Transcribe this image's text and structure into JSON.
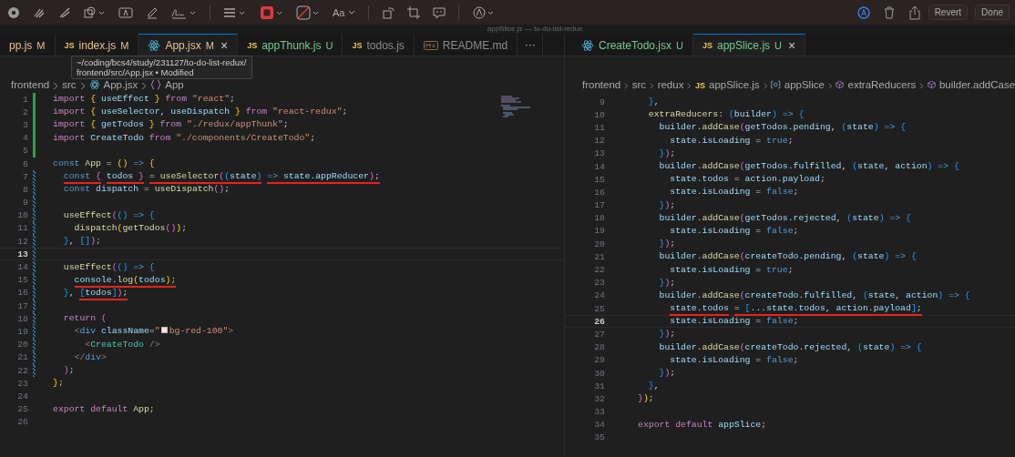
{
  "toolbar": {
    "font_label": "Aa",
    "buttons": [
      "Revert",
      "Done"
    ]
  },
  "window": {
    "title": "appSlice.js — to-do-list-redux"
  },
  "tooltip": {
    "lines": [
      "~/coding/bcs4/study/231127/to-do-list-redux/",
      "frontend/src/App.jsx • Modified"
    ]
  },
  "editors": [
    {
      "tabs": [
        {
          "label": "pp.js",
          "kind": "none",
          "status": "M",
          "color": "#e2c08d",
          "selected": false
        },
        {
          "label": "index.js",
          "kind": "js",
          "icon_text": "JS",
          "status": "M",
          "color": "#e2c08d",
          "selected": false
        },
        {
          "label": "App.jsx",
          "kind": "react",
          "status": "M",
          "color": "#e2c08d",
          "selected": true,
          "close": "×"
        },
        {
          "label": "appThunk.js",
          "kind": "js",
          "icon_text": "JS",
          "status": "U",
          "color": "#73c991",
          "selected": false
        },
        {
          "label": "todos.js",
          "kind": "js",
          "icon_text": "JS",
          "color": "#8b8b8b",
          "selected": false
        },
        {
          "label": "README.md",
          "kind": "markdown",
          "color": "#8b8b8b",
          "selected": false
        }
      ],
      "overflow_button": "···",
      "breadcrumb": [
        {
          "text": "frontend",
          "kind": "folder"
        },
        {
          "text": "src",
          "kind": "folder"
        },
        {
          "text": "App.jsx",
          "kind": "react"
        },
        {
          "text": "App",
          "kind": "symbol"
        }
      ],
      "lines": [
        {
          "number": "1",
          "added": true,
          "modified": false,
          "current": false,
          "tokens": [
            {
              "text": "import ",
              "kind": "kw"
            },
            {
              "text": "{",
              "kind": "br1"
            },
            {
              "text": " useEffect ",
              "kind": "var"
            },
            {
              "text": "}",
              "kind": "br1"
            },
            {
              "text": " from ",
              "kind": "kw"
            },
            {
              "text": "\"react\"",
              "kind": "str"
            },
            {
              "text": ";",
              "kind": "punc"
            }
          ]
        },
        {
          "number": "2",
          "added": true,
          "modified": false,
          "current": false,
          "tokens": [
            {
              "text": "import ",
              "kind": "kw"
            },
            {
              "text": "{",
              "kind": "br1"
            },
            {
              "text": " useSelector, useDispatch ",
              "kind": "var"
            },
            {
              "text": "}",
              "kind": "br1"
            },
            {
              "text": " from ",
              "kind": "kw"
            },
            {
              "text": "\"react-redux\"",
              "kind": "str"
            },
            {
              "text": ";",
              "kind": "punc"
            }
          ]
        },
        {
          "number": "3",
          "added": true,
          "modified": false,
          "current": false,
          "tokens": [
            {
              "text": "import ",
              "kind": "kw"
            },
            {
              "text": "{",
              "kind": "br1"
            },
            {
              "text": " getTodos ",
              "kind": "var"
            },
            {
              "text": "}",
              "kind": "br1"
            },
            {
              "text": " from ",
              "kind": "kw"
            },
            {
              "text": "\"./redux/appThunk\"",
              "kind": "str"
            },
            {
              "text": ";",
              "kind": "punc"
            }
          ]
        },
        {
          "number": "4",
          "added": true,
          "modified": false,
          "current": false,
          "tokens": [
            {
              "text": "import ",
              "kind": "kw"
            },
            {
              "text": "CreateTodo",
              "kind": "var"
            },
            {
              "text": " from ",
              "kind": "kw"
            },
            {
              "text": "\"./components/CreateTodo\"",
              "kind": "str"
            },
            {
              "text": ";",
              "kind": "punc"
            }
          ]
        },
        {
          "number": "5",
          "added": true,
          "modified": false,
          "current": false
        },
        {
          "number": "6",
          "added": false,
          "modified": false,
          "current": false,
          "tokens": [
            {
              "text": "const ",
              "kind": "decl"
            },
            {
              "text": "App",
              "kind": "fn"
            },
            {
              "text": " = ",
              "kind": "punc"
            },
            {
              "text": "()",
              "kind": "br1"
            },
            {
              "text": " => ",
              "kind": "decl"
            },
            {
              "text": "{",
              "kind": "br1"
            }
          ]
        },
        {
          "number": "7",
          "added": false,
          "modified": true,
          "current": false,
          "tokens": [
            {
              "text": "  const ",
              "kind": "decl",
              "underlined": true
            },
            {
              "text": "{",
              "kind": "br2",
              "underlined": true
            },
            {
              "text": " todos ",
              "kind": "var",
              "underlined": true
            },
            {
              "text": "}",
              "kind": "br2",
              "underlined": true
            },
            {
              "text": " = ",
              "kind": "punc",
              "underlined": true
            },
            {
              "text": "useSelector",
              "kind": "fn",
              "underlined": true
            },
            {
              "text": "(",
              "kind": "br2",
              "underlined": true
            },
            {
              "text": "(",
              "kind": "br3",
              "underlined": true
            },
            {
              "text": "state",
              "kind": "var",
              "underlined": true
            },
            {
              "text": ")",
              "kind": "br3",
              "underlined": true
            },
            {
              "text": " => ",
              "kind": "decl",
              "underlined": true
            },
            {
              "text": "state.appReducer",
              "kind": "var",
              "underlined": true
            },
            {
              "text": ")",
              "kind": "br2",
              "underlined": true
            },
            {
              "text": ";",
              "kind": "punc",
              "underlined": true
            }
          ]
        },
        {
          "number": "8",
          "added": false,
          "modified": true,
          "current": false,
          "tokens": [
            {
              "text": "  const ",
              "kind": "decl"
            },
            {
              "text": "dispatch",
              "kind": "var"
            },
            {
              "text": " = ",
              "kind": "punc"
            },
            {
              "text": "useDispatch",
              "kind": "fn"
            },
            {
              "text": "()",
              "kind": "br2"
            },
            {
              "text": ";",
              "kind": "punc"
            }
          ]
        },
        {
          "number": "9",
          "added": false,
          "modified": true,
          "current": false
        },
        {
          "number": "10",
          "added": false,
          "modified": true,
          "current": false,
          "tokens": [
            {
              "text": "  useEffect",
              "kind": "fn"
            },
            {
              "text": "(",
              "kind": "br2"
            },
            {
              "text": "()",
              "kind": "br3"
            },
            {
              "text": " => ",
              "kind": "decl"
            },
            {
              "text": "{",
              "kind": "br3"
            }
          ]
        },
        {
          "number": "11",
          "added": false,
          "modified": true,
          "current": false,
          "tokens": [
            {
              "text": "    dispatch",
              "kind": "fn"
            },
            {
              "text": "(",
              "kind": "br1"
            },
            {
              "text": "getTodos",
              "kind": "fn"
            },
            {
              "text": "()",
              "kind": "br2"
            },
            {
              "text": ")",
              "kind": "br1"
            },
            {
              "text": ";",
              "kind": "punc"
            }
          ]
        },
        {
          "number": "12",
          "added": false,
          "modified": true,
          "current": false,
          "tokens": [
            {
              "text": "  }",
              "kind": "br3"
            },
            {
              "text": ", ",
              "kind": "punc"
            },
            {
              "text": "[]",
              "kind": "br3"
            },
            {
              "text": ")",
              "kind": "br2"
            },
            {
              "text": ";",
              "kind": "punc"
            }
          ]
        },
        {
          "number": "13",
          "added": false,
          "modified": true,
          "current": true
        },
        {
          "number": "14",
          "added": false,
          "modified": true,
          "current": false,
          "tokens": [
            {
              "text": "  useEffect",
              "kind": "fn"
            },
            {
              "text": "(",
              "kind": "br2"
            },
            {
              "text": "()",
              "kind": "br3"
            },
            {
              "text": " => ",
              "kind": "decl"
            },
            {
              "text": "{",
              "kind": "br3"
            }
          ]
        },
        {
          "number": "15",
          "added": false,
          "modified": true,
          "current": false,
          "tokens": [
            {
              "text": "    console",
              "kind": "var",
              "underlined": true
            },
            {
              "text": ".",
              "kind": "punc",
              "underlined": true
            },
            {
              "text": "log",
              "kind": "fn",
              "underlined": true
            },
            {
              "text": "(",
              "kind": "br1",
              "underlined": true
            },
            {
              "text": "todos",
              "kind": "var",
              "underlined": true
            },
            {
              "text": ")",
              "kind": "br1",
              "underlined": true
            },
            {
              "text": ";",
              "kind": "punc",
              "underlined": true
            }
          ]
        },
        {
          "number": "16",
          "added": false,
          "modified": true,
          "current": false,
          "tokens": [
            {
              "text": "  }",
              "kind": "br3"
            },
            {
              "text": ", ",
              "kind": "punc"
            },
            {
              "text": "[",
              "kind": "br3",
              "underlined": true
            },
            {
              "text": "todos",
              "kind": "var",
              "underlined": true
            },
            {
              "text": "]",
              "kind": "br3",
              "underlined": true
            },
            {
              "text": ")",
              "kind": "br2",
              "underlined": true
            },
            {
              "text": ";",
              "kind": "punc",
              "underlined": true
            }
          ]
        },
        {
          "number": "17",
          "added": false,
          "modified": true,
          "current": false
        },
        {
          "number": "18",
          "added": false,
          "modified": true,
          "current": false,
          "tokens": [
            {
              "text": "  return ",
              "kind": "kw"
            },
            {
              "text": "(",
              "kind": "br2"
            }
          ]
        },
        {
          "number": "19",
          "added": false,
          "modified": true,
          "current": false,
          "tokens": [
            {
              "text": "    <",
              "kind": "angle"
            },
            {
              "text": "div",
              "kind": "tag"
            },
            {
              "text": " className",
              "kind": "attr"
            },
            {
              "text": "=",
              "kind": "punc"
            },
            {
              "text": "\"",
              "kind": "str"
            },
            {
              "kind": "swatch",
              "color": "#fee2e2"
            },
            {
              "text": "bg-red-100\"",
              "kind": "str"
            },
            {
              "text": ">",
              "kind": "angle"
            }
          ]
        },
        {
          "number": "20",
          "added": false,
          "modified": true,
          "current": false,
          "tokens": [
            {
              "text": "      <",
              "kind": "angle"
            },
            {
              "text": "CreateTodo",
              "kind": "type"
            },
            {
              "text": " />",
              "kind": "angle"
            }
          ]
        },
        {
          "number": "21",
          "added": false,
          "modified": true,
          "current": false,
          "tokens": [
            {
              "text": "    </",
              "kind": "angle"
            },
            {
              "text": "div",
              "kind": "tag"
            },
            {
              "text": ">",
              "kind": "angle"
            }
          ]
        },
        {
          "number": "22",
          "added": false,
          "modified": true,
          "current": false,
          "tokens": [
            {
              "text": "  )",
              "kind": "br2"
            },
            {
              "text": ";",
              "kind": "punc"
            }
          ]
        },
        {
          "number": "23",
          "added": false,
          "modified": false,
          "current": false,
          "tokens": [
            {
              "text": "}",
              "kind": "br1"
            },
            {
              "text": ";",
              "kind": "punc"
            }
          ]
        },
        {
          "number": "24",
          "added": false,
          "modified": false,
          "current": false
        },
        {
          "number": "25",
          "added": false,
          "modified": false,
          "current": false,
          "tokens": [
            {
              "text": "export default ",
              "kind": "kw"
            },
            {
              "text": "App",
              "kind": "fn"
            },
            {
              "text": ";",
              "kind": "punc"
            }
          ]
        },
        {
          "number": "26",
          "added": false,
          "modified": false,
          "current": false
        }
      ]
    },
    {
      "tabs": [
        {
          "label": "CreateTodo.jsx",
          "kind": "react",
          "status": "U",
          "color": "#73c991",
          "selected": false
        },
        {
          "label": "appSlice.js",
          "kind": "js",
          "icon_text": "JS",
          "status": "U",
          "color": "#73c991",
          "selected": true,
          "close": "×"
        }
      ],
      "breadcrumb": [
        {
          "text": "frontend",
          "kind": "folder"
        },
        {
          "text": "src",
          "kind": "folder"
        },
        {
          "text": "redux",
          "kind": "folder"
        },
        {
          "text": "appSlice.js",
          "kind": "js",
          "icon_text": "JS"
        },
        {
          "text": "appSlice",
          "kind": "variable"
        },
        {
          "text": "extraReducers",
          "kind": "method"
        },
        {
          "text": "builder.addCase",
          "kind": "method"
        }
      ],
      "lines": [
        {
          "number": "9",
          "current": false,
          "tokens": [
            {
              "text": "  }",
              "kind": "br3"
            },
            {
              "text": ",",
              "kind": "punc"
            }
          ]
        },
        {
          "number": "10",
          "current": false,
          "tokens": [
            {
              "text": "  extraReducers",
              "kind": "fn"
            },
            {
              "text": ": ",
              "kind": "punc"
            },
            {
              "text": "(",
              "kind": "br3"
            },
            {
              "text": "builder",
              "kind": "var"
            },
            {
              "text": ")",
              "kind": "br3"
            },
            {
              "text": " => ",
              "kind": "decl"
            },
            {
              "text": "{",
              "kind": "br3"
            }
          ]
        },
        {
          "number": "11",
          "current": false,
          "tokens": [
            {
              "text": "    builder.",
              "kind": "var"
            },
            {
              "text": "addCase",
              "kind": "fn"
            },
            {
              "text": "(",
              "kind": "br2"
            },
            {
              "text": "getTodos.pending",
              "kind": "var"
            },
            {
              "text": ", ",
              "kind": "punc"
            },
            {
              "text": "(",
              "kind": "br3"
            },
            {
              "text": "state",
              "kind": "var"
            },
            {
              "text": ")",
              "kind": "br3"
            },
            {
              "text": " => ",
              "kind": "decl"
            },
            {
              "text": "{",
              "kind": "br3"
            }
          ]
        },
        {
          "number": "12",
          "current": false,
          "tokens": [
            {
              "text": "      state.isLoading",
              "kind": "var"
            },
            {
              "text": " = ",
              "kind": "punc"
            },
            {
              "text": "true",
              "kind": "decl"
            },
            {
              "text": ";",
              "kind": "punc"
            }
          ]
        },
        {
          "number": "13",
          "current": false,
          "tokens": [
            {
              "text": "    }",
              "kind": "br3"
            },
            {
              "text": ")",
              "kind": "br2"
            },
            {
              "text": ";",
              "kind": "punc"
            }
          ]
        },
        {
          "number": "14",
          "current": false,
          "tokens": [
            {
              "text": "    builder.",
              "kind": "var"
            },
            {
              "text": "addCase",
              "kind": "fn"
            },
            {
              "text": "(",
              "kind": "br2"
            },
            {
              "text": "getTodos.fulfilled",
              "kind": "var"
            },
            {
              "text": ", ",
              "kind": "punc"
            },
            {
              "text": "(",
              "kind": "br3"
            },
            {
              "text": "state, action",
              "kind": "var"
            },
            {
              "text": ")",
              "kind": "br3"
            },
            {
              "text": " => ",
              "kind": "decl"
            },
            {
              "text": "{",
              "kind": "br3"
            }
          ]
        },
        {
          "number": "15",
          "current": false,
          "tokens": [
            {
              "text": "      state.todos",
              "kind": "var"
            },
            {
              "text": " = ",
              "kind": "punc"
            },
            {
              "text": "action.payload",
              "kind": "var"
            },
            {
              "text": ";",
              "kind": "punc"
            }
          ]
        },
        {
          "number": "16",
          "current": false,
          "tokens": [
            {
              "text": "      state.isLoading",
              "kind": "var"
            },
            {
              "text": " = ",
              "kind": "punc"
            },
            {
              "text": "false",
              "kind": "decl"
            },
            {
              "text": ";",
              "kind": "punc"
            }
          ]
        },
        {
          "number": "17",
          "current": false,
          "tokens": [
            {
              "text": "    }",
              "kind": "br3"
            },
            {
              "text": ")",
              "kind": "br2"
            },
            {
              "text": ";",
              "kind": "punc"
            }
          ]
        },
        {
          "number": "18",
          "current": false,
          "tokens": [
            {
              "text": "    builder.",
              "kind": "var"
            },
            {
              "text": "addCase",
              "kind": "fn"
            },
            {
              "text": "(",
              "kind": "br2"
            },
            {
              "text": "getTodos.rejected",
              "kind": "var"
            },
            {
              "text": ", ",
              "kind": "punc"
            },
            {
              "text": "(",
              "kind": "br3"
            },
            {
              "text": "state",
              "kind": "var"
            },
            {
              "text": ")",
              "kind": "br3"
            },
            {
              "text": " => ",
              "kind": "decl"
            },
            {
              "text": "{",
              "kind": "br3"
            }
          ]
        },
        {
          "number": "19",
          "current": false,
          "tokens": [
            {
              "text": "      state.isLoading",
              "kind": "var"
            },
            {
              "text": " = ",
              "kind": "punc"
            },
            {
              "text": "false",
              "kind": "decl"
            },
            {
              "text": ";",
              "kind": "punc"
            }
          ]
        },
        {
          "number": "20",
          "current": false,
          "tokens": [
            {
              "text": "    }",
              "kind": "br3"
            },
            {
              "text": ")",
              "kind": "br2"
            },
            {
              "text": ";",
              "kind": "punc"
            }
          ]
        },
        {
          "number": "21",
          "current": false,
          "tokens": [
            {
              "text": "    builder.",
              "kind": "var"
            },
            {
              "text": "addCase",
              "kind": "fn"
            },
            {
              "text": "(",
              "kind": "br2"
            },
            {
              "text": "createTodo.pending",
              "kind": "var"
            },
            {
              "text": ", ",
              "kind": "punc"
            },
            {
              "text": "(",
              "kind": "br3"
            },
            {
              "text": "state",
              "kind": "var"
            },
            {
              "text": ")",
              "kind": "br3"
            },
            {
              "text": " => ",
              "kind": "decl"
            },
            {
              "text": "{",
              "kind": "br3"
            }
          ]
        },
        {
          "number": "22",
          "current": false,
          "tokens": [
            {
              "text": "      state.isLoading",
              "kind": "var"
            },
            {
              "text": " = ",
              "kind": "punc"
            },
            {
              "text": "true",
              "kind": "decl"
            },
            {
              "text": ";",
              "kind": "punc"
            }
          ]
        },
        {
          "number": "23",
          "current": false,
          "tokens": [
            {
              "text": "    }",
              "kind": "br3"
            },
            {
              "text": ")",
              "kind": "br2"
            },
            {
              "text": ";",
              "kind": "punc"
            }
          ]
        },
        {
          "number": "24",
          "current": false,
          "tokens": [
            {
              "text": "    builder.",
              "kind": "var"
            },
            {
              "text": "addCase",
              "kind": "fn"
            },
            {
              "text": "(",
              "kind": "br2"
            },
            {
              "text": "createTodo.fulfilled",
              "kind": "var"
            },
            {
              "text": ", ",
              "kind": "punc"
            },
            {
              "text": "(",
              "kind": "br3"
            },
            {
              "text": "state, action",
              "kind": "var"
            },
            {
              "text": ")",
              "kind": "br3"
            },
            {
              "text": " => ",
              "kind": "decl"
            },
            {
              "text": "{",
              "kind": "br3"
            }
          ]
        },
        {
          "number": "25",
          "current": false,
          "tokens": [
            {
              "text": "      state.todos",
              "kind": "var",
              "underlined": true
            },
            {
              "text": " = ",
              "kind": "punc",
              "underlined": true
            },
            {
              "text": "[",
              "kind": "br3",
              "underlined": true
            },
            {
              "text": "...state.todos, action.payload",
              "kind": "var",
              "underlined": true
            },
            {
              "text": "]",
              "kind": "br3",
              "underlined": true
            },
            {
              "text": ";",
              "kind": "punc",
              "underlined": true
            }
          ]
        },
        {
          "number": "26",
          "current": true,
          "tokens": [
            {
              "text": "      state.isLoading",
              "kind": "var"
            },
            {
              "text": " = ",
              "kind": "punc"
            },
            {
              "text": "false",
              "kind": "decl"
            },
            {
              "text": ";",
              "kind": "punc"
            }
          ]
        },
        {
          "number": "27",
          "current": false,
          "tokens": [
            {
              "text": "    }",
              "kind": "br3"
            },
            {
              "text": ")",
              "kind": "br2"
            },
            {
              "text": ";",
              "kind": "punc"
            }
          ]
        },
        {
          "number": "28",
          "current": false,
          "tokens": [
            {
              "text": "    builder.",
              "kind": "var"
            },
            {
              "text": "addCase",
              "kind": "fn"
            },
            {
              "text": "(",
              "kind": "br2"
            },
            {
              "text": "createTodo.rejected",
              "kind": "var"
            },
            {
              "text": ", ",
              "kind": "punc"
            },
            {
              "text": "(",
              "kind": "br3"
            },
            {
              "text": "state",
              "kind": "var"
            },
            {
              "text": ")",
              "kind": "br3"
            },
            {
              "text": " => ",
              "kind": "decl"
            },
            {
              "text": "{",
              "kind": "br3"
            }
          ]
        },
        {
          "number": "29",
          "current": false,
          "tokens": [
            {
              "text": "      state.isLoading",
              "kind": "var"
            },
            {
              "text": " = ",
              "kind": "punc"
            },
            {
              "text": "false",
              "kind": "decl"
            },
            {
              "text": ";",
              "kind": "punc"
            }
          ]
        },
        {
          "number": "30",
          "current": false,
          "tokens": [
            {
              "text": "    }",
              "kind": "br3"
            },
            {
              "text": ")",
              "kind": "br2"
            },
            {
              "text": ";",
              "kind": "punc"
            }
          ]
        },
        {
          "number": "31",
          "current": false,
          "tokens": [
            {
              "text": "  }",
              "kind": "br3"
            },
            {
              "text": ",",
              "kind": "punc"
            }
          ]
        },
        {
          "number": "32",
          "current": false,
          "tokens": [
            {
              "text": "}",
              "kind": "br2"
            },
            {
              "text": ")",
              "kind": "br1"
            },
            {
              "text": ";",
              "kind": "punc"
            }
          ]
        },
        {
          "number": "33",
          "current": false
        },
        {
          "number": "34",
          "current": false,
          "tokens": [
            {
              "text": "export default ",
              "kind": "kw"
            },
            {
              "text": "appSlice",
              "kind": "var"
            },
            {
              "text": ";",
              "kind": "punc"
            }
          ]
        },
        {
          "number": "35",
          "current": false
        }
      ]
    }
  ]
}
